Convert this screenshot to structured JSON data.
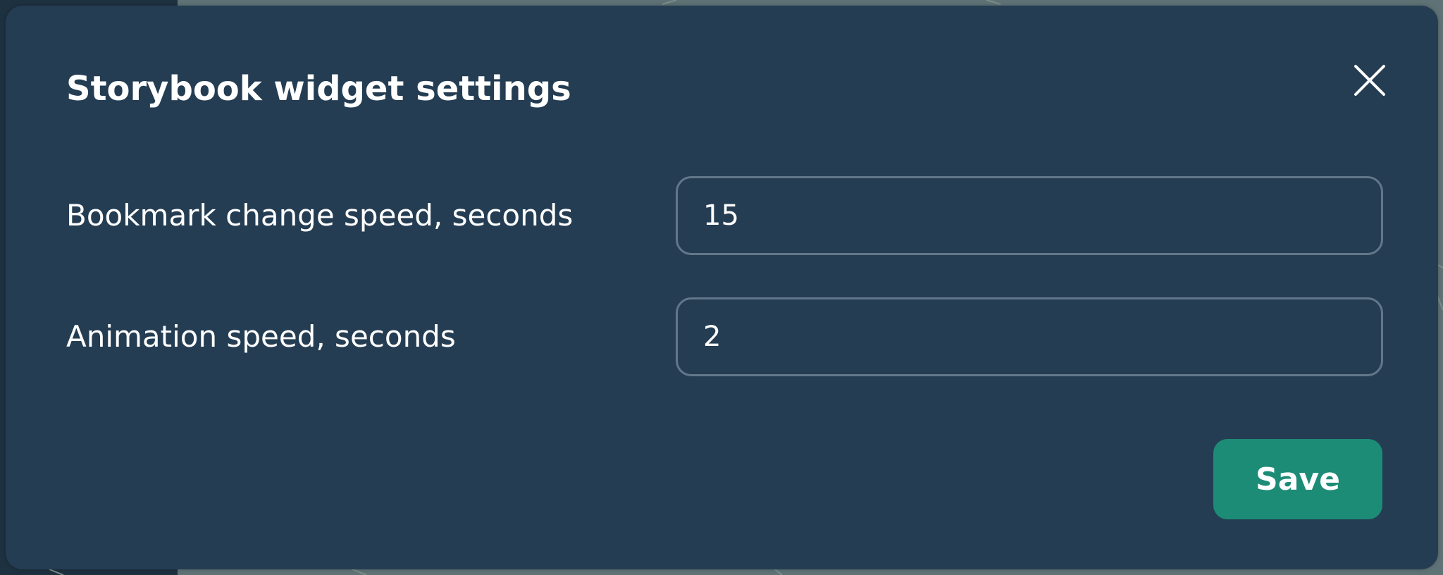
{
  "dialog": {
    "title": "Storybook widget settings",
    "close_icon": "close-icon",
    "fields": [
      {
        "label": "Bookmark change speed, seconds",
        "value": "15"
      },
      {
        "label": "Animation speed, seconds",
        "value": "2"
      }
    ],
    "save_label": "Save"
  },
  "colors": {
    "dialog_background": "#243d53",
    "save_button": "#1d8c76",
    "input_border": "#62778a",
    "text": "#ffffff"
  }
}
